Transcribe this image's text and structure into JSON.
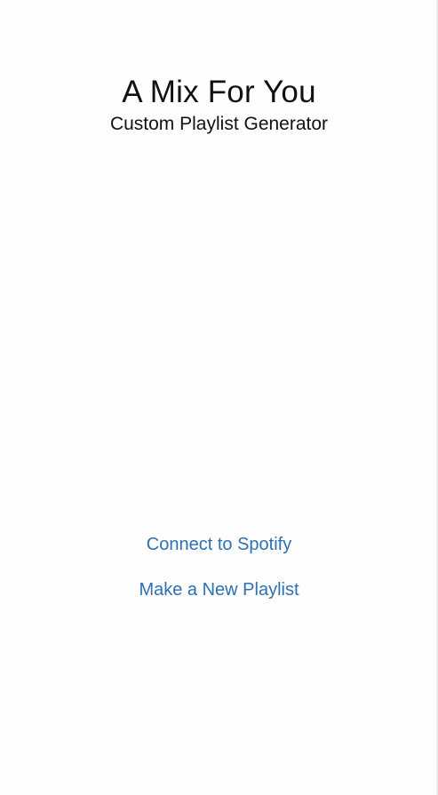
{
  "header": {
    "title": "A Mix For You",
    "subtitle": "Custom Playlist Generator"
  },
  "actions": {
    "connect_label": "Connect to Spotify",
    "new_playlist_label": "Make a New Playlist"
  },
  "colors": {
    "accent": "#2f6fb5",
    "text": "#111111",
    "background": "#fefefe"
  }
}
